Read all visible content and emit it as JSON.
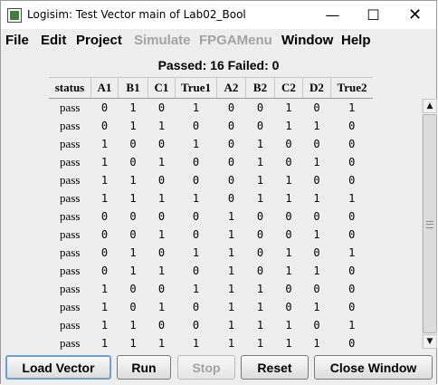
{
  "window": {
    "title": "Logisim: Test Vector main of Lab02_Bool",
    "controls": {
      "minimize": "—",
      "maximize": "☐",
      "close": "✕"
    }
  },
  "menu": [
    {
      "label": "File",
      "enabled": true
    },
    {
      "label": "Edit",
      "enabled": true
    },
    {
      "label": "Project",
      "enabled": true
    },
    {
      "label": "Simulate",
      "enabled": false
    },
    {
      "label": "FPGAMenu",
      "enabled": false
    },
    {
      "label": "Window",
      "enabled": true
    },
    {
      "label": "Help",
      "enabled": true
    }
  ],
  "summary": "Passed: 16 Failed: 0",
  "table": {
    "columns": [
      "status",
      "A1",
      "B1",
      "C1",
      "True1",
      "A2",
      "B2",
      "C2",
      "D2",
      "True2"
    ],
    "rows": [
      [
        "pass",
        "0",
        "1",
        "0",
        "1",
        "0",
        "0",
        "1",
        "0",
        "1"
      ],
      [
        "pass",
        "0",
        "1",
        "1",
        "0",
        "0",
        "0",
        "1",
        "1",
        "0"
      ],
      [
        "pass",
        "1",
        "0",
        "0",
        "1",
        "0",
        "1",
        "0",
        "0",
        "0"
      ],
      [
        "pass",
        "1",
        "0",
        "1",
        "0",
        "0",
        "1",
        "0",
        "1",
        "0"
      ],
      [
        "pass",
        "1",
        "1",
        "0",
        "0",
        "0",
        "1",
        "1",
        "0",
        "0"
      ],
      [
        "pass",
        "1",
        "1",
        "1",
        "1",
        "0",
        "1",
        "1",
        "1",
        "1"
      ],
      [
        "pass",
        "0",
        "0",
        "0",
        "0",
        "1",
        "0",
        "0",
        "0",
        "0"
      ],
      [
        "pass",
        "0",
        "0",
        "1",
        "0",
        "1",
        "0",
        "0",
        "1",
        "0"
      ],
      [
        "pass",
        "0",
        "1",
        "0",
        "1",
        "1",
        "0",
        "1",
        "0",
        "1"
      ],
      [
        "pass",
        "0",
        "1",
        "1",
        "0",
        "1",
        "0",
        "1",
        "1",
        "0"
      ],
      [
        "pass",
        "1",
        "0",
        "0",
        "1",
        "1",
        "1",
        "0",
        "0",
        "0"
      ],
      [
        "pass",
        "1",
        "0",
        "1",
        "0",
        "1",
        "1",
        "0",
        "1",
        "0"
      ],
      [
        "pass",
        "1",
        "1",
        "0",
        "0",
        "1",
        "1",
        "1",
        "0",
        "1"
      ],
      [
        "pass",
        "1",
        "1",
        "1",
        "1",
        "1",
        "1",
        "1",
        "1",
        "0"
      ]
    ]
  },
  "scrollbar": {
    "up_arrow": "▲",
    "down_arrow": "▼"
  },
  "buttons": {
    "load_vector": "Load Vector",
    "run": "Run",
    "stop": "Stop",
    "reset": "Reset",
    "close_window": "Close Window"
  }
}
